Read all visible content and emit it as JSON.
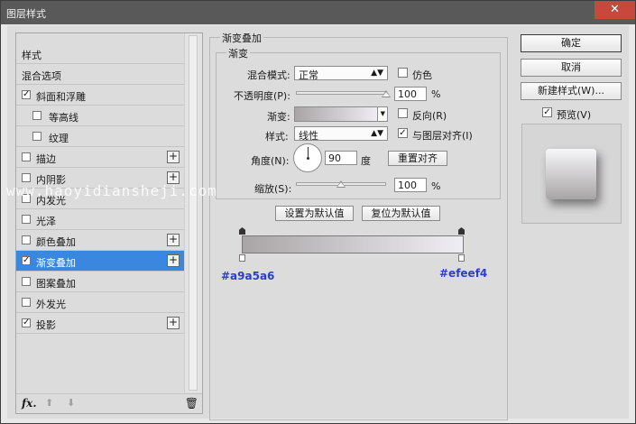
{
  "window": {
    "title": "图层样式",
    "close_glyph": "✕"
  },
  "styles_list": {
    "items": [
      {
        "label": "样式",
        "checkbox": false,
        "checked": false,
        "plus": false,
        "selected": false,
        "indent": false
      },
      {
        "label": "混合选项",
        "checkbox": false,
        "checked": false,
        "plus": false,
        "selected": false,
        "indent": false
      },
      {
        "label": "斜面和浮雕",
        "checkbox": true,
        "checked": true,
        "plus": false,
        "selected": false,
        "indent": false
      },
      {
        "label": "等高线",
        "checkbox": true,
        "checked": false,
        "plus": false,
        "selected": false,
        "indent": true
      },
      {
        "label": "纹理",
        "checkbox": true,
        "checked": false,
        "plus": false,
        "selected": false,
        "indent": true
      },
      {
        "label": "描边",
        "checkbox": true,
        "checked": false,
        "plus": true,
        "selected": false,
        "indent": false
      },
      {
        "label": "内阴影",
        "checkbox": true,
        "checked": false,
        "plus": true,
        "selected": false,
        "indent": false
      },
      {
        "label": "内发光",
        "checkbox": true,
        "checked": false,
        "plus": false,
        "selected": false,
        "indent": false
      },
      {
        "label": "光泽",
        "checkbox": true,
        "checked": false,
        "plus": false,
        "selected": false,
        "indent": false
      },
      {
        "label": "颜色叠加",
        "checkbox": true,
        "checked": false,
        "plus": true,
        "selected": false,
        "indent": false
      },
      {
        "label": "渐变叠加",
        "checkbox": true,
        "checked": true,
        "plus": true,
        "selected": true,
        "indent": false
      },
      {
        "label": "图案叠加",
        "checkbox": true,
        "checked": false,
        "plus": false,
        "selected": false,
        "indent": false
      },
      {
        "label": "外发光",
        "checkbox": true,
        "checked": false,
        "plus": false,
        "selected": false,
        "indent": false
      },
      {
        "label": "投影",
        "checkbox": true,
        "checked": true,
        "plus": true,
        "selected": false,
        "indent": false
      }
    ],
    "footer": {
      "fx_label": "fx",
      "fx_suffix": ".",
      "up_glyph": "⬆",
      "down_glyph": "⬇",
      "trash_glyph": "🗑"
    }
  },
  "gradient_overlay": {
    "section_title": "渐变叠加",
    "group_title": "渐变",
    "blend_mode_label": "混合模式:",
    "blend_mode_value": "正常",
    "dither_label": "仿色",
    "dither_checked": false,
    "opacity_label": "不透明度(P):",
    "opacity_value": "100",
    "opacity_fraction": 1.0,
    "percent_sign": "%",
    "gradient_label": "渐变:",
    "reverse_label": "反向(R)",
    "reverse_checked": false,
    "style_label": "样式:",
    "style_value": "线性",
    "align_label": "与图层对齐(I)",
    "align_checked": true,
    "angle_label": "角度(N):",
    "angle_value": "90",
    "degree_label": "度",
    "reset_align_button": "重置对齐",
    "scale_label": "缩放(S):",
    "scale_value": "100",
    "scale_fraction": 0.5,
    "set_default_button": "设置为默认值",
    "reset_default_button": "复位为默认值",
    "check_glyph": "✓",
    "dropdown_arrow": "▲▼"
  },
  "gradient_bar": {
    "start_color": "#a9a5a6",
    "end_color": "#efeef4",
    "start_label": "#a9a5a6",
    "end_label": "#efeef4"
  },
  "watermark": "www.haoyidiansheji.com",
  "right_panel": {
    "ok_button": "确定",
    "cancel_button": "取消",
    "new_style_button": "新建样式(W)...",
    "preview_label": "预览(V)",
    "preview_checked": true
  }
}
